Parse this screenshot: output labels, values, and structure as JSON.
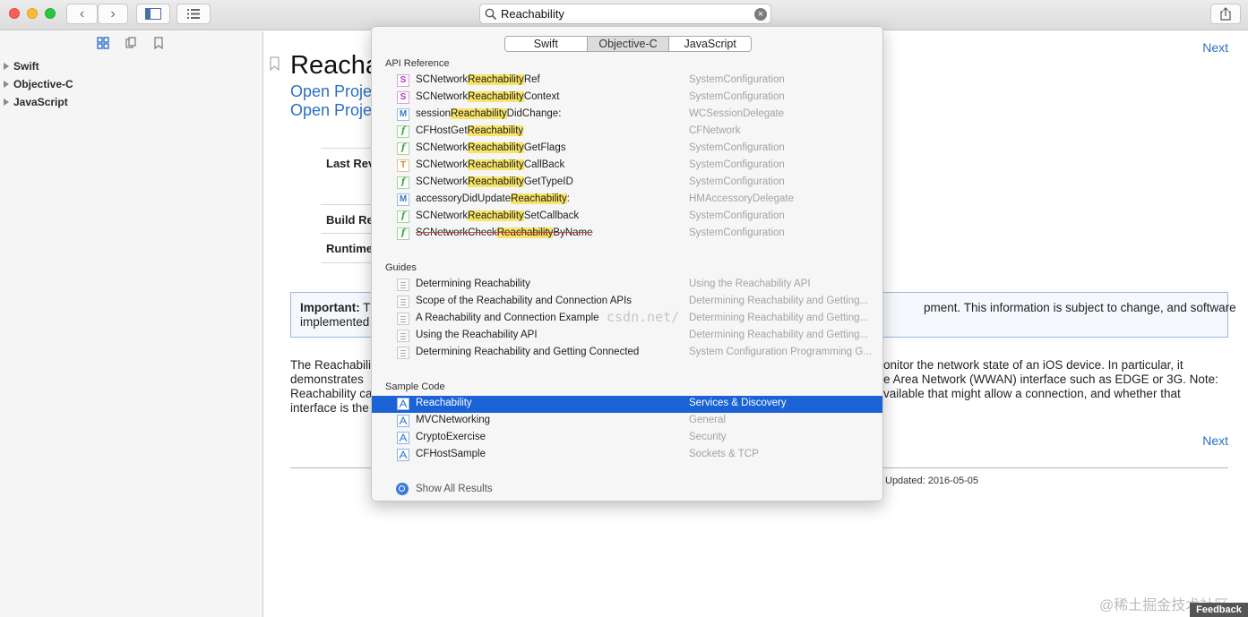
{
  "toolbar": {
    "search_value": "Reachability",
    "back_icon": "‹",
    "forward_icon": "›",
    "share_icon": "share-icon"
  },
  "sidebar": {
    "items": [
      {
        "label": "Swift"
      },
      {
        "label": "Objective-C"
      },
      {
        "label": "JavaScript"
      }
    ]
  },
  "doc": {
    "title": "Reacha",
    "link1": "Open Proje",
    "link2": "Open Proje",
    "next1": "Next",
    "next2": "Next",
    "last_rev": "Last Rev",
    "build_req": "Build Re",
    "runtime": "Runtime",
    "important_label": "Important:",
    "important_left_1": " T",
    "important_left_2": "implemented",
    "important_right": "pment. This information is subject to change, and software",
    "para_left": [
      "The Reachabili",
      "demonstrates",
      "Reachability ca",
      "interface is the"
    ],
    "para_right": [
      "onitor the network state of an iOS device. In particular, it",
      "e Area Network (WWAN) interface such as EDGE or 3G. Note:",
      "vailable that might allow a connection, and whether that",
      ""
    ],
    "updated": "Updated: 2016-05-05"
  },
  "popover": {
    "tabs": [
      "Swift",
      "Objective-C",
      "JavaScript"
    ],
    "active_tab": "Objective-C",
    "sections": {
      "api": "API Reference",
      "guides": "Guides",
      "sample": "Sample Code"
    },
    "api_rows": [
      {
        "icon": "S",
        "pre": "SCNetwork",
        "hl": "Reachability",
        "post": "Ref",
        "ctx": "SystemConfiguration"
      },
      {
        "icon": "S",
        "pre": "SCNetwork",
        "hl": "Reachability",
        "post": "Context",
        "ctx": "SystemConfiguration"
      },
      {
        "icon": "M",
        "pre": "session",
        "hl": "Reachability",
        "post": "DidChange:",
        "ctx": "WCSessionDelegate"
      },
      {
        "icon": "f",
        "pre": "CFHostGet",
        "hl": "Reachability",
        "post": "",
        "ctx": "CFNetwork"
      },
      {
        "icon": "f",
        "pre": "SCNetwork",
        "hl": "Reachability",
        "post": "GetFlags",
        "ctx": "SystemConfiguration"
      },
      {
        "icon": "T",
        "pre": "SCNetwork",
        "hl": "Reachability",
        "post": "CallBack",
        "ctx": "SystemConfiguration"
      },
      {
        "icon": "f",
        "pre": "SCNetwork",
        "hl": "Reachability",
        "post": "GetTypeID",
        "ctx": "SystemConfiguration"
      },
      {
        "icon": "M",
        "pre": "accessoryDidUpdate",
        "hl": "Reachability",
        "post": ":",
        "ctx": "HMAccessoryDelegate"
      },
      {
        "icon": "f",
        "pre": "SCNetwork",
        "hl": "Reachability",
        "post": "SetCallback",
        "ctx": "SystemConfiguration"
      },
      {
        "icon": "f",
        "pre": "SCNetworkCheck",
        "hl": "Reachability",
        "post": "ByName",
        "ctx": "SystemConfiguration"
      }
    ],
    "guide_rows": [
      {
        "name": "Determining Reachability",
        "ctx": "Using the Reachability API"
      },
      {
        "name": "Scope of the Reachability and Connection APIs",
        "ctx": "Determining Reachability and Getting..."
      },
      {
        "name": "A Reachability and Connection Example",
        "ctx": "Determining Reachability and Getting..."
      },
      {
        "name": "Using the Reachability API",
        "ctx": "Determining Reachability and Getting..."
      },
      {
        "name": "Determining Reachability and Getting Connected",
        "ctx": "System Configuration Programming G..."
      }
    ],
    "sample_rows": [
      {
        "name": "Reachability",
        "ctx": "Services & Discovery"
      },
      {
        "name": "MVCNetworking",
        "ctx": "General"
      },
      {
        "name": "CryptoExercise",
        "ctx": "Security"
      },
      {
        "name": "CFHostSample",
        "ctx": "Sockets & TCP"
      }
    ],
    "show_all": "Show All Results"
  },
  "watermarks": {
    "csdn": "csdn.net/",
    "corner": "@稀土掘金技术社区"
  },
  "feedback": "Feedback",
  "colors": {
    "accent": "#1a62d6",
    "link": "#2b6fc4",
    "highlight": "#f7e469"
  }
}
